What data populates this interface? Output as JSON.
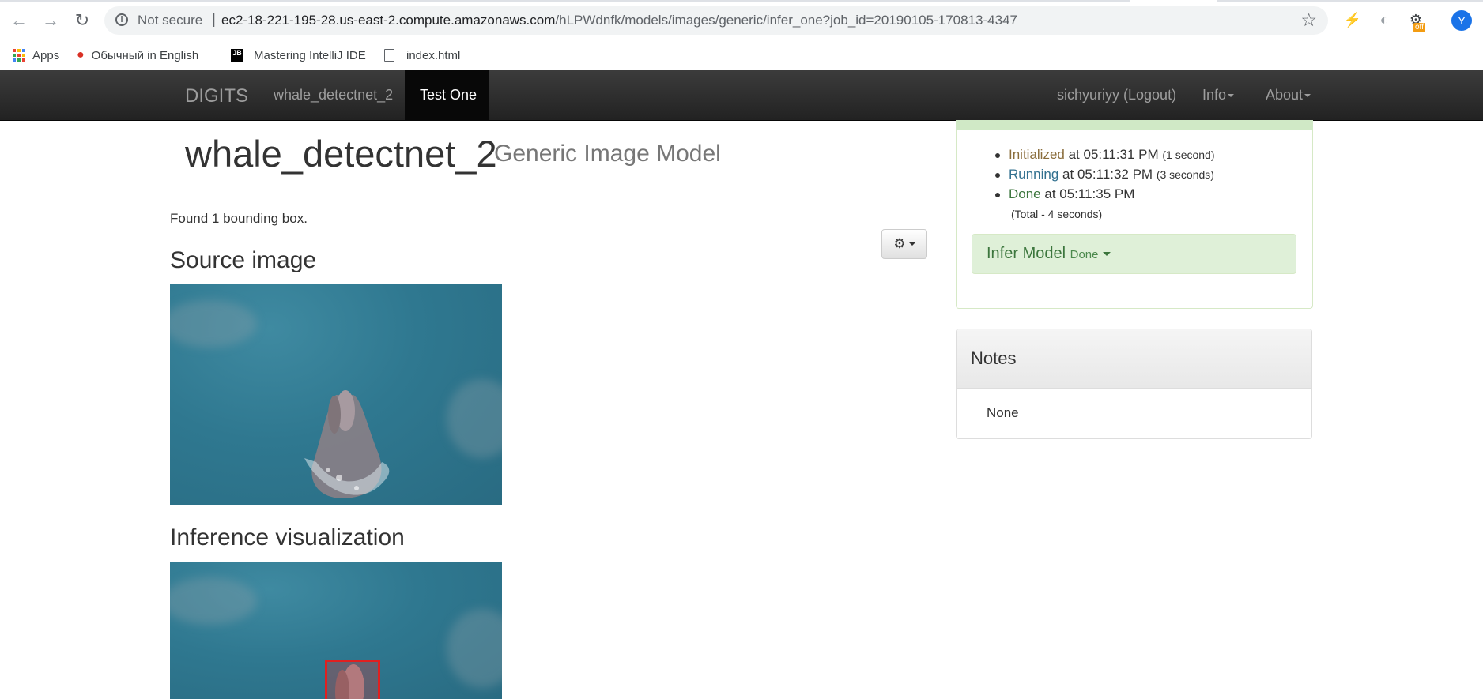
{
  "browser": {
    "not_secure_label": "Not secure",
    "separator": "|",
    "url_host": "ec2-18-221-195-28.us-east-2.compute.amazonaws.com",
    "url_path": "/hLPWdnfk/models/images/generic/infer_one?job_id=20190105-170813-4347",
    "extension_badge": "off",
    "profile_initial": "Y",
    "bookmarks": [
      {
        "label": "Apps"
      },
      {
        "label": "Обычный in English"
      },
      {
        "label": "Mastering IntelliJ IDE"
      },
      {
        "label": "index.html"
      }
    ],
    "jb_icon_text": "JB"
  },
  "navbar": {
    "brand": "DIGITS",
    "model_link": "whale_detectnet_2",
    "active_tab": "Test One",
    "user_link": "sichyuriyy (Logout)",
    "info_menu": "Info",
    "about_menu": "About"
  },
  "main": {
    "title": "whale_detectnet_2",
    "subtitle": "Generic Image Model",
    "found_text": "Found 1 bounding box.",
    "source_heading": "Source image",
    "inference_heading": "Inference visualization"
  },
  "status": {
    "items": [
      {
        "state": "Initialized",
        "at": " at 05:11:31 PM ",
        "duration": "(1 second)"
      },
      {
        "state": "Running",
        "at": " at 05:11:32 PM ",
        "duration": "(3 seconds)"
      },
      {
        "state": "Done",
        "at": " at 05:11:35 PM",
        "duration": ""
      }
    ],
    "total": "(Total - 4 seconds)",
    "infer_label": "Infer Model",
    "infer_status": "Done"
  },
  "notes": {
    "heading": "Notes",
    "body": "None"
  },
  "colors": {
    "navbar_bg": "#222222",
    "success_bg": "#dff0d8",
    "success_text": "#3c763d",
    "bbox": "#e02020"
  }
}
